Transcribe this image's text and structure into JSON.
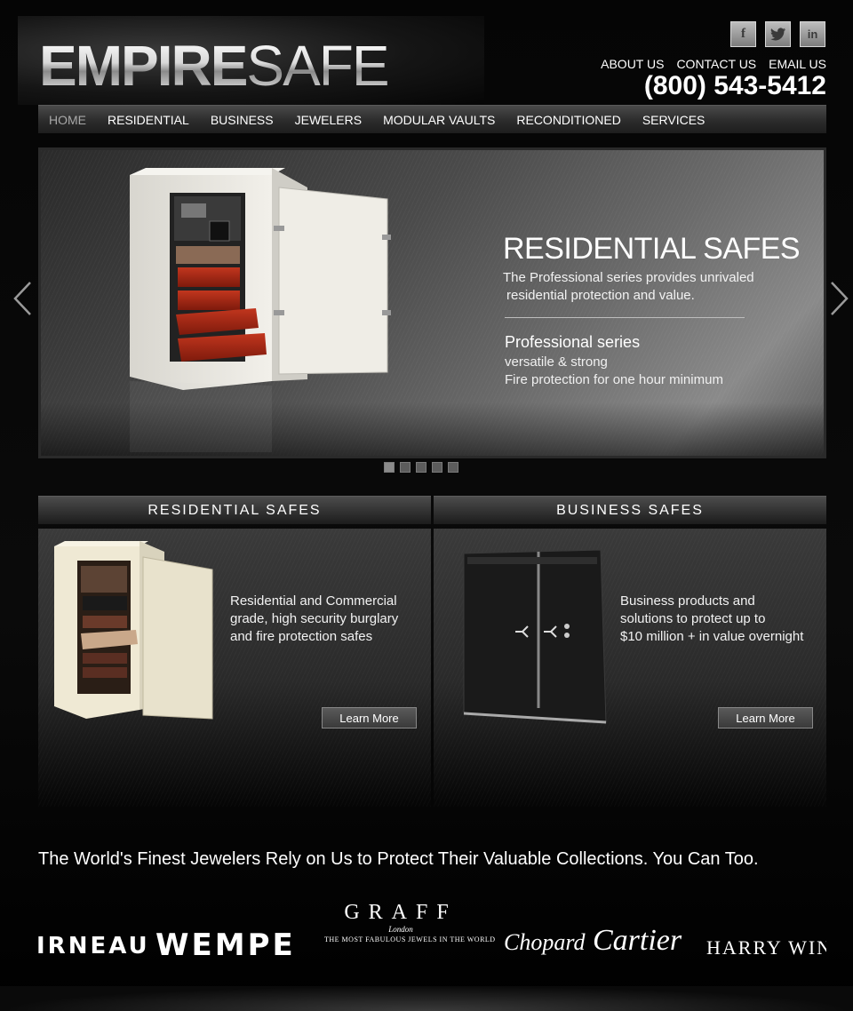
{
  "logo": {
    "bold": "EMPIRE",
    "light": "SAFE"
  },
  "social": [
    {
      "name": "facebook",
      "glyph": "f"
    },
    {
      "name": "twitter",
      "glyph": "t"
    },
    {
      "name": "linkedin",
      "glyph": "in"
    }
  ],
  "top_links": {
    "about": "ABOUT US",
    "contact": "CONTACT US",
    "email": "EMAIL US"
  },
  "phone": "(800) 543-5412",
  "nav": [
    "HOME",
    "RESIDENTIAL",
    "BUSINESS",
    "JEWELERS",
    "MODULAR VAULTS",
    "RECONDITIONED",
    "SERVICES"
  ],
  "slider": {
    "title": "RESIDENTIAL SAFES",
    "desc_1": "The Professional series provides unrivaled",
    "desc_2": "residential protection and value.",
    "subtitle": "Professional series",
    "line_1": "versatile & strong",
    "line_2": "Fire protection for one hour minimum",
    "slide_count": 5,
    "active_slide": 1
  },
  "panels": {
    "residential": {
      "title": "RESIDENTIAL SAFES",
      "line_1": "Residential and Commercial",
      "line_2": "grade, high security burglary",
      "line_3": "and fire protection safes",
      "button": "Learn More"
    },
    "business": {
      "title": "BUSINESS SAFES",
      "line_1": "Business products and",
      "line_2": "solutions to protect up to",
      "line_3": "$10 million + in value overnight",
      "button": "Learn More"
    }
  },
  "tagline": "The World's Finest Jewelers Rely on Us to Protect Their Valuable Collections. You Can Too.",
  "brands": {
    "b1": "IRNEAU",
    "b2": "WEMPE",
    "graff": "GRAFF",
    "graff_city": "London",
    "graff_tag": "THE MOST FABULOUS JEWELS IN THE WORLD",
    "chopard": "Chopard",
    "cartier": "Cartier",
    "harry": "HARRY WIN"
  }
}
